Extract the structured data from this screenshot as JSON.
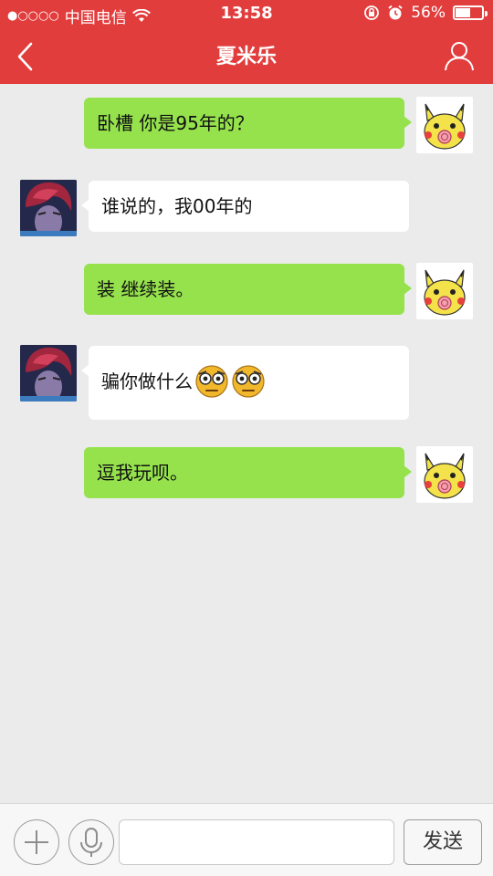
{
  "status_bar": {
    "signal_dots": "●○○○○",
    "carrier": "中国电信",
    "time": "13:58",
    "battery_percent": "56%",
    "battery_level": 0.56
  },
  "header": {
    "title": "夏米乐"
  },
  "messages": [
    {
      "sender": "me",
      "text": "卧槽 你是95年的？"
    },
    {
      "sender": "peer",
      "text": "谁说的，我00年的"
    },
    {
      "sender": "me",
      "text": "装 继续装。"
    },
    {
      "sender": "peer",
      "text": "骗你做什么",
      "emojis": [
        "staring-face-emoji",
        "staring-face-emoji"
      ]
    },
    {
      "sender": "me",
      "text": "逗我玩呗。"
    }
  ],
  "composer": {
    "input_value": "",
    "send_label": "发送"
  },
  "colors": {
    "header": "#e23d3d",
    "my_bubble": "#95e24d",
    "peer_bubble": "#ffffff",
    "chat_background": "#ebebeb"
  }
}
